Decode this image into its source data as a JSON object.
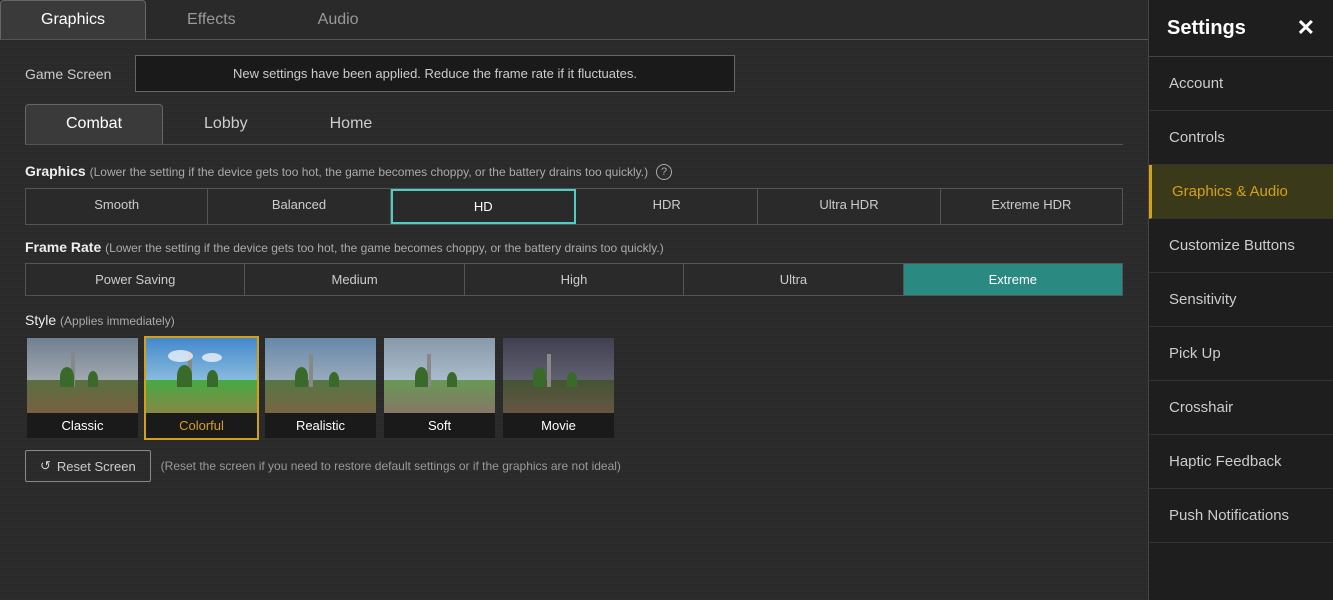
{
  "top_tabs": [
    {
      "label": "Graphics",
      "active": true
    },
    {
      "label": "Effects",
      "active": false
    },
    {
      "label": "Audio",
      "active": false
    }
  ],
  "game_screen": {
    "label": "Game Screen",
    "notification": "New settings have been applied. Reduce the frame rate if it fluctuates."
  },
  "sub_tabs": [
    {
      "label": "Combat",
      "active": true
    },
    {
      "label": "Lobby",
      "active": false
    },
    {
      "label": "Home",
      "active": false
    }
  ],
  "graphics_section": {
    "main_label": "Graphics",
    "desc": "(Lower the setting if the device gets too hot, the game becomes choppy, or the battery drains too quickly.)",
    "options": [
      "Smooth",
      "Balanced",
      "HD",
      "HDR",
      "Ultra HDR",
      "Extreme HDR"
    ],
    "active": "HD"
  },
  "frame_rate_section": {
    "main_label": "Frame Rate",
    "desc": "(Lower the setting if the device gets too hot, the game becomes choppy, or the battery drains too quickly.)",
    "options": [
      "Power Saving",
      "Medium",
      "High",
      "Ultra",
      "Extreme"
    ],
    "active": "Extreme"
  },
  "style_section": {
    "main_label": "Style",
    "applies_label": "(Applies immediately)",
    "cards": [
      {
        "name": "Classic",
        "selected": false
      },
      {
        "name": "Colorful",
        "selected": true
      },
      {
        "name": "Realistic",
        "selected": false
      },
      {
        "name": "Soft",
        "selected": false
      },
      {
        "name": "Movie",
        "selected": false
      }
    ]
  },
  "reset": {
    "button_label": "Reset Screen",
    "desc": "(Reset the screen if you need to restore default settings or if the graphics are not ideal)"
  },
  "sidebar": {
    "title": "Settings",
    "close_label": "✕",
    "items": [
      {
        "label": "Account",
        "active": false
      },
      {
        "label": "Controls",
        "active": false
      },
      {
        "label": "Graphics & Audio",
        "active": true
      },
      {
        "label": "Customize Buttons",
        "active": false
      },
      {
        "label": "Sensitivity",
        "active": false
      },
      {
        "label": "Pick Up",
        "active": false
      },
      {
        "label": "Crosshair",
        "active": false
      },
      {
        "label": "Haptic Feedback",
        "active": false
      },
      {
        "label": "Push Notifications",
        "active": false
      }
    ]
  }
}
